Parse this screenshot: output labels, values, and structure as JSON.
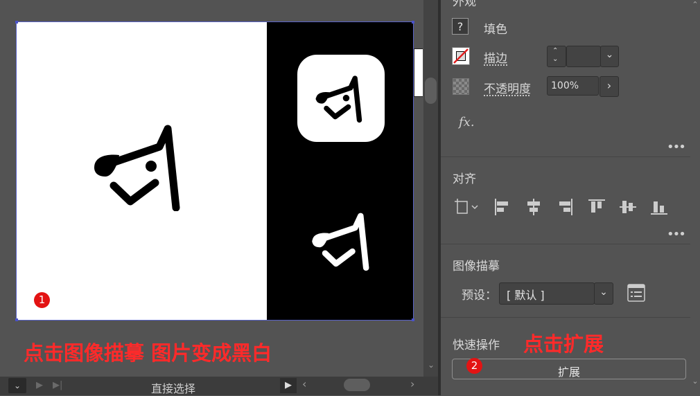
{
  "appearance": {
    "section_title": "外观",
    "fill_label": "填色",
    "fill_icon": "question-mark-icon",
    "stroke_label": "描边",
    "stroke_weight": "",
    "opacity_label": "不透明度",
    "opacity_value": "100%",
    "fx_label": "fx."
  },
  "align": {
    "section_title": "对齐"
  },
  "image_trace": {
    "section_title": "图像描摹",
    "preset_label": "预设：",
    "preset_value": "[ 默认 ]"
  },
  "quick_actions": {
    "section_title": "快速操作",
    "expand_button": "扩展"
  },
  "bottom_bar": {
    "tool_name": "直接选择"
  },
  "annotations": {
    "left_text": "点击图像描摹 图片变成黑白",
    "right_text": "点击扩展",
    "badge_1": "1",
    "badge_2": "2"
  },
  "colors": {
    "panel_bg": "#535353",
    "annotation_red": "#ff2a2a",
    "badge_red": "#e31313",
    "selection_blue": "#5a64c8"
  }
}
